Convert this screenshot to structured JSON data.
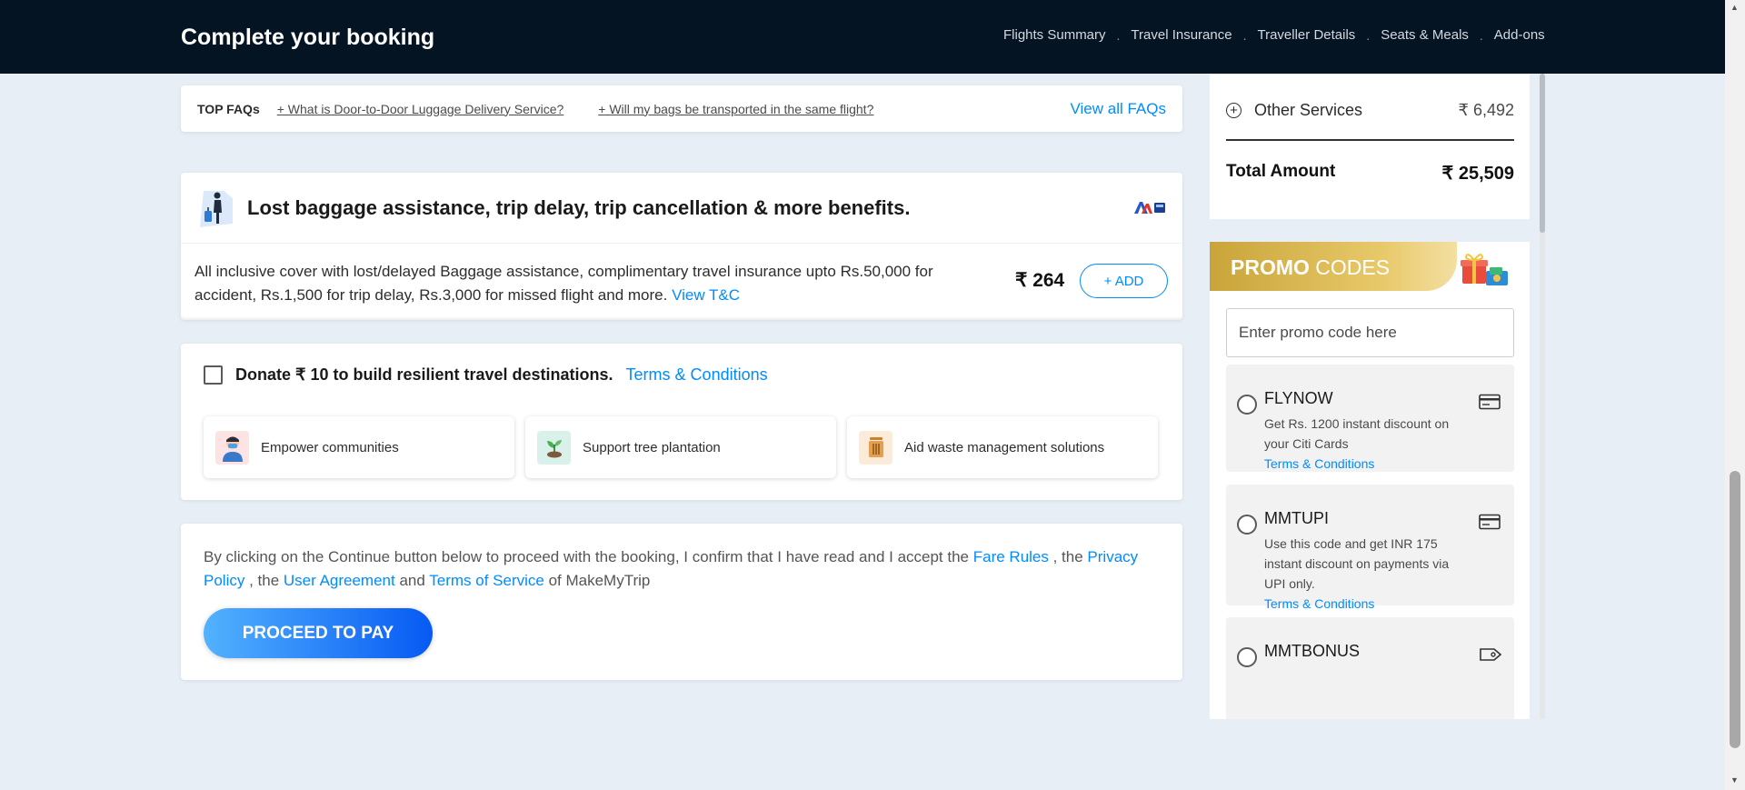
{
  "header": {
    "title": "Complete your booking",
    "nav": [
      "Flights Summary",
      "Travel Insurance",
      "Traveller Details",
      "Seats & Meals",
      "Add-ons"
    ]
  },
  "faq": {
    "label": "TOP FAQs",
    "questions": [
      "+ What is Door-to-Door Luggage Delivery Service?",
      "+ Will my bags be transported in the same flight?"
    ],
    "view_all": "View all FAQs"
  },
  "insurance": {
    "title": "Lost baggage assistance, trip delay, trip cancellation & more benefits.",
    "description": "All inclusive cover with lost/delayed Baggage assistance, complimentary travel insurance upto Rs.50,000 for accident, Rs.1,500 for trip delay, Rs.3,000 for missed flight and more.",
    "tc_link": "View T&C",
    "price": "₹ 264",
    "add_label": "+ ADD"
  },
  "donate": {
    "text": "Donate ₹ 10 to build resilient travel destinations.",
    "tc_link": "Terms & Conditions",
    "tiles": [
      "Empower communities",
      "Support tree plantation",
      "Aid waste management solutions"
    ]
  },
  "consent": {
    "part1": "By clicking on the Continue button below to proceed with the booking, I confirm that I have read and I accept the ",
    "fare_rules": "Fare Rules",
    "part2": " , the ",
    "privacy": "Privacy Policy",
    "part3": " , the ",
    "user_agreement": "User Agreement",
    "part4": " and ",
    "terms": "Terms of Service",
    "part5": " of MakeMyTrip",
    "button": "PROCEED TO PAY"
  },
  "fare_summary": {
    "other_services_label": "Other Services",
    "other_services_value": "₹ 6,492",
    "total_label": "Total Amount",
    "total_value": "₹ 25,509"
  },
  "promo": {
    "title_bold": "PROMO",
    "title_rest": " CODES",
    "placeholder": "Enter promo code here",
    "codes": [
      {
        "code": "FLYNOW",
        "desc": "Get Rs. 1200 instant discount on your Citi Cards",
        "tc": "Terms & Conditions"
      },
      {
        "code": "MMTUPI",
        "desc": "Use this code and get INR 175 instant discount on payments via UPI only.",
        "tc": "Terms & Conditions"
      },
      {
        "code": "MMTBONUS",
        "desc": "",
        "tc": ""
      }
    ]
  },
  "colors": {
    "header_bg": "#051423",
    "accent": "#008cff",
    "page_bg": "#e7eef5",
    "promo_gold": "#c9a43a"
  }
}
